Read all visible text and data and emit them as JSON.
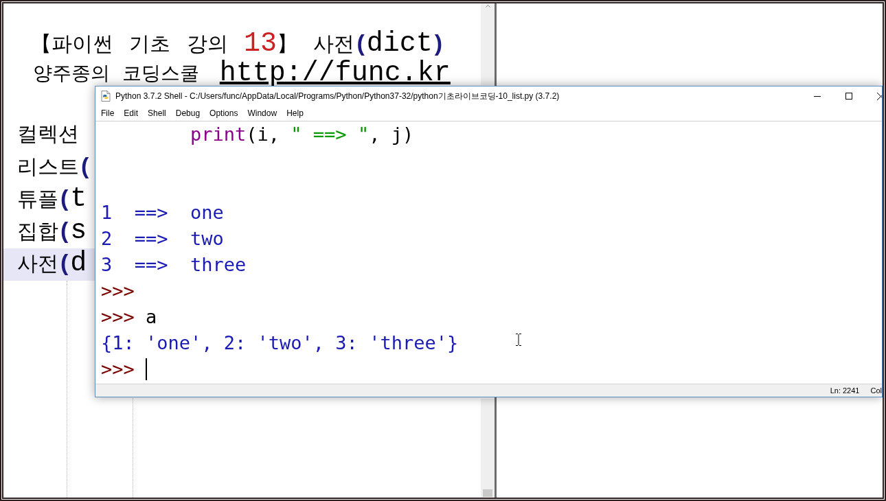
{
  "slide": {
    "title": [
      {
        "kind": "text",
        "text": "【파이썬 기초 강의 "
      },
      {
        "kind": "number",
        "text": "13"
      },
      {
        "kind": "text",
        "text": "】 사전"
      },
      {
        "kind": "paren",
        "text": "("
      },
      {
        "kind": "latin",
        "text": "dict"
      },
      {
        "kind": "paren",
        "text": ")"
      }
    ],
    "subtitle": "양주종의 코딩스쿨",
    "link": "http://func.kr",
    "items": [
      {
        "selected": false,
        "parts": [
          {
            "kind": "text",
            "text": "컬렉션"
          }
        ]
      },
      {
        "selected": false,
        "parts": [
          {
            "kind": "text",
            "text": "리스트"
          },
          {
            "kind": "paren",
            "text": "("
          }
        ]
      },
      {
        "selected": false,
        "parts": [
          {
            "kind": "text",
            "text": "튜플"
          },
          {
            "kind": "paren",
            "text": "("
          },
          {
            "kind": "latin",
            "text": "t"
          }
        ]
      },
      {
        "selected": false,
        "parts": [
          {
            "kind": "text",
            "text": "집합"
          },
          {
            "kind": "paren",
            "text": "("
          },
          {
            "kind": "latin",
            "text": "s"
          }
        ]
      },
      {
        "selected": true,
        "parts": [
          {
            "kind": "text",
            "text": "사전"
          },
          {
            "kind": "paren",
            "text": "("
          },
          {
            "kind": "latin",
            "text": "d"
          }
        ]
      }
    ]
  },
  "shell": {
    "window": {
      "title": "Python 3.7.2 Shell - C:/Users/func/AppData/Local/Programs/Python/Python37-32/python기초라이브코딩-10_list.py (3.7.2)"
    },
    "menu": [
      "File",
      "Edit",
      "Shell",
      "Debug",
      "Options",
      "Window",
      "Help"
    ],
    "lines": [
      {
        "kind": "continuation",
        "segments": [
          {
            "kind": "keyword",
            "text": "print"
          },
          {
            "kind": "plain",
            "text": "(i, "
          },
          {
            "kind": "string",
            "text": "\" ==> \""
          },
          {
            "kind": "plain",
            "text": ", j)"
          }
        ]
      },
      {
        "kind": "output",
        "segments": [
          {
            "kind": "output",
            "text": "1  ==>  one"
          }
        ]
      },
      {
        "kind": "output",
        "segments": [
          {
            "kind": "output",
            "text": "2  ==>  two"
          }
        ]
      },
      {
        "kind": "output",
        "segments": [
          {
            "kind": "output",
            "text": "3  ==>  three"
          }
        ]
      },
      {
        "kind": "prompt",
        "segments": [
          {
            "kind": "prompt",
            "text": ">>>"
          }
        ]
      },
      {
        "kind": "prompt",
        "segments": [
          {
            "kind": "prompt",
            "text": ">>>"
          },
          {
            "kind": "plain",
            "text": "a"
          }
        ]
      },
      {
        "kind": "output",
        "segments": [
          {
            "kind": "output",
            "text": "{1: 'one', 2: 'two', 3: 'three'}"
          }
        ]
      },
      {
        "kind": "prompt",
        "caret": true,
        "segments": [
          {
            "kind": "prompt",
            "text": ">>>"
          }
        ]
      }
    ],
    "status_bar": {
      "line": "Ln: 2241",
      "column": "Col"
    }
  }
}
